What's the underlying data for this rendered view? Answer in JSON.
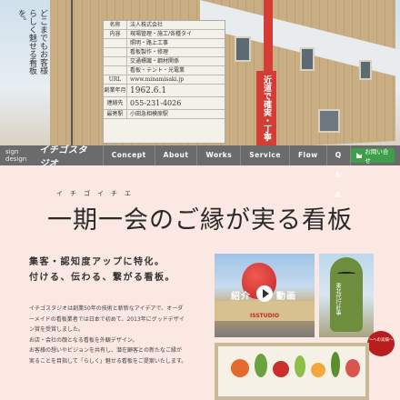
{
  "hero": {
    "tagline": "どこまでもお客様らしく魅せる看板を。",
    "sign_rows": [
      {
        "k": "名称",
        "v": "法人株式会社"
      },
      {
        "k": "内容",
        "v": "現場管理・施工/各種タイ"
      },
      {
        "k": "",
        "v": "照明・路上工事"
      },
      {
        "k": "",
        "v": "看板製作・修理"
      },
      {
        "k": "",
        "v": "交通標識・鋼材関係"
      },
      {
        "k": "",
        "v": "看板・テント・光電業"
      },
      {
        "k": "URL",
        "v": "www.minamisaki.jp"
      },
      {
        "k": "創業年月",
        "v": "1962.6.1"
      },
      {
        "k": "連絡先",
        "v": "055-231-4026"
      },
      {
        "k": "最寄駅",
        "v": "小田急相模原駅"
      }
    ],
    "red_sign_text": "近道で確実・丁寧"
  },
  "nav": {
    "logo_small": "sign design",
    "logo": "イチゴスタジオ",
    "items": [
      "Concept",
      "About",
      "Works",
      "Service",
      "Flow",
      "Q & A"
    ],
    "contact": "お問い合せ"
  },
  "headline": {
    "ruby": "イチゴイチエ",
    "title": "一期一会のご縁が実る看板"
  },
  "copy": {
    "lead1": "集客・認知度アップに特化。",
    "lead2": "付ける、伝わる、繋がる看板。",
    "body": [
      "イチゴスタジオは創業50年の技術と斬新なアイデアで、オーダ",
      "ーメイドの看板業者では日本で初めて、2013年にグッドデザイ",
      "ン賞を受賞しました。",
      "お店・会社の顔となる看板を外観デザイン。",
      "お客様の想いやビジョンを共有し、潜在顧客との新たなご縁が",
      "実ることを目指して「らしく」魅せる看板をご提案いたします。"
    ]
  },
  "media": {
    "video_left": "紹介",
    "video_right": "動画",
    "store_name": "ISSTUDIO",
    "photo2_text": "東北代行計事",
    "badge": "〜への実績〜"
  }
}
